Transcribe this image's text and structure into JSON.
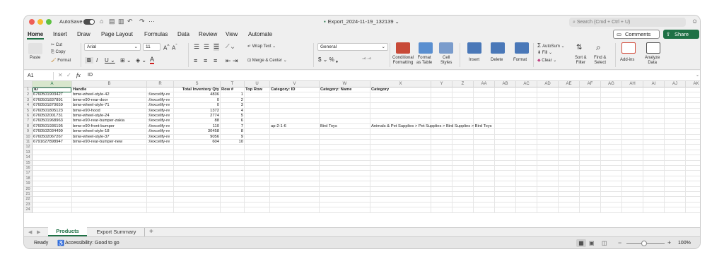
{
  "titlebar": {
    "autosave": "AutoSave",
    "title": "Export_2024-11-19_132139",
    "search_placeholder": "Search (Cmd + Ctrl + U)"
  },
  "menu": [
    "Home",
    "Insert",
    "Draw",
    "Page Layout",
    "Formulas",
    "Data",
    "Review",
    "View",
    "Automate"
  ],
  "menu_right": {
    "comments": "Comments",
    "share": "Share"
  },
  "ribbon": {
    "paste": "Paste",
    "cut": "Cut",
    "copy": "Copy",
    "format_painter": "Format",
    "font_name": "Arial",
    "font_size": "11",
    "wrap_text": "Wrap Text",
    "merge_center": "Merge & Center",
    "number_format": "General",
    "conditional_formatting": [
      "Conditional",
      "Formatting"
    ],
    "format_as_table": [
      "Format",
      "as Table"
    ],
    "cell_styles": [
      "Cell",
      "Styles"
    ],
    "insert": "Insert",
    "delete": "Delete",
    "format": "Format",
    "autosum": "AutoSum",
    "fill": "Fill",
    "clear": "Clear",
    "sort_filter": [
      "Sort &",
      "Filter"
    ],
    "find_select": [
      "Find &",
      "Select"
    ],
    "addins": "Add-ins",
    "analyze_data": [
      "Analyze",
      "Data"
    ]
  },
  "formula_bar": {
    "name_box": "A1",
    "fx": "fx",
    "content": "ID"
  },
  "columns": [
    {
      "letter": "A"
    },
    {
      "letter": "B"
    },
    {
      "letter": "R"
    },
    {
      "letter": "S"
    },
    {
      "letter": "T"
    },
    {
      "letter": "U"
    },
    {
      "letter": "V"
    },
    {
      "letter": "W"
    },
    {
      "letter": "X"
    },
    {
      "letter": "Y"
    },
    {
      "letter": "Z"
    },
    {
      "letter": "AA"
    },
    {
      "letter": "AB"
    },
    {
      "letter": "AC"
    },
    {
      "letter": "AD"
    },
    {
      "letter": "AE"
    },
    {
      "letter": "AF"
    },
    {
      "letter": "AG"
    },
    {
      "letter": "AH"
    },
    {
      "letter": "AI"
    },
    {
      "letter": "AJ"
    },
    {
      "letter": "AK"
    }
  ],
  "headers": [
    "ID",
    "Handle",
    "",
    "Total Inventory Qty",
    "Row #",
    "Top Row",
    "Category: ID",
    "Category: Name",
    "Category"
  ],
  "rows": [
    [
      "6760501903427",
      "bmw-wheel-style-42",
      "://excelify-re",
      "4836",
      "1",
      "",
      "",
      "",
      ""
    ],
    [
      "6760501837891",
      "bmw-e90-rear-door",
      "://excelify-re",
      "0",
      "2",
      "",
      "",
      "",
      ""
    ],
    [
      "6760501870659",
      "bmw-wheel-style-71",
      "://excelify-re",
      "0",
      "3",
      "",
      "",
      "",
      ""
    ],
    [
      "6760501805123",
      "bmw-e90-hood",
      "://excelify-re",
      "1372",
      "4",
      "",
      "",
      "",
      ""
    ],
    [
      "6760502001731",
      "bmw-wheel-style-24",
      "://excelify-re",
      "2774",
      "5",
      "",
      "",
      "",
      ""
    ],
    [
      "6760501968963",
      "bmw-e90-rear-bumper-zakia",
      "://excelify-re",
      "88",
      "6",
      "",
      "",
      "",
      ""
    ],
    [
      "6760501936195",
      "bmw-e90-front-bumper",
      "://excelify-re",
      "110",
      "7",
      "",
      "ap-2-1-6",
      "Bird Toys",
      "Animals & Pet Supplies > Pet Supplies > Bird Supplies > Bird Toys"
    ],
    [
      "6760502034499",
      "bmw-wheel-style-18",
      "://excelify-re",
      "30458",
      "8",
      "",
      "",
      "",
      ""
    ],
    [
      "6760502067267",
      "bmw-wheel-style-37",
      "://excelify-re",
      "9056",
      "9",
      "",
      "",
      "",
      ""
    ],
    [
      "6791627898947",
      "bmw-e90-rear-bumper-new",
      "://excelify-re",
      "604",
      "10",
      "",
      "",
      "",
      ""
    ]
  ],
  "row_numbers": [
    "1",
    "2",
    "3",
    "4",
    "5",
    "6",
    "7",
    "8",
    "9",
    "10",
    "11",
    "12",
    "13",
    "14",
    "15",
    "16",
    "17",
    "18",
    "19",
    "20",
    "21",
    "22",
    "23",
    "24"
  ],
  "sheets": {
    "active": "Products",
    "other": "Export Summary",
    "add": "+"
  },
  "status": {
    "ready": "Ready",
    "accessibility": "Accessibility: Good to go",
    "zoom": "100%"
  }
}
